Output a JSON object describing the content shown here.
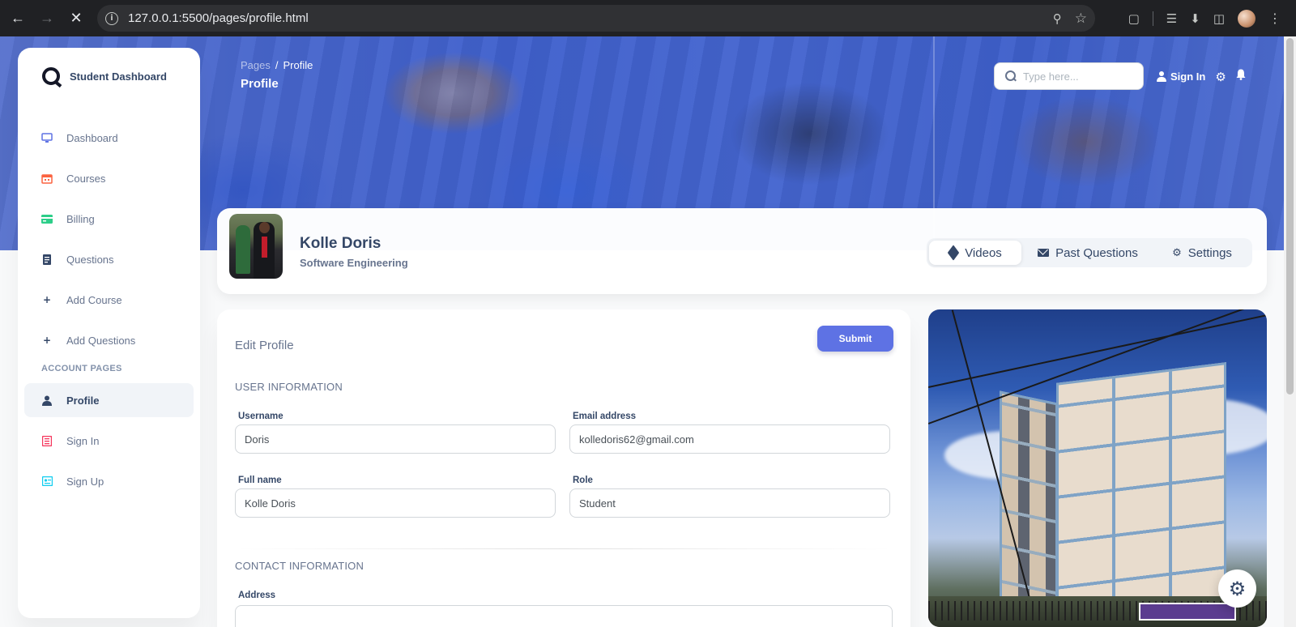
{
  "browser": {
    "url": "127.0.0.1:5500/pages/profile.html"
  },
  "sidebar": {
    "brand": "Student Dashboard",
    "items": [
      {
        "label": "Dashboard",
        "icon": "desktop-icon",
        "color": "#5e72e4"
      },
      {
        "label": "Courses",
        "icon": "calendar-icon",
        "color": "#fb6340"
      },
      {
        "label": "Billing",
        "icon": "credit-card-icon",
        "color": "#2dce89"
      },
      {
        "label": "Questions",
        "icon": "book-icon",
        "color": "#344767"
      },
      {
        "label": "Add Course",
        "icon": "plus-icon",
        "color": "#344767"
      },
      {
        "label": "Add Questions",
        "icon": "plus-icon",
        "color": "#344767"
      }
    ],
    "section_heading": "ACCOUNT PAGES",
    "account_items": [
      {
        "label": "Profile",
        "icon": "user-icon",
        "color": "#344767",
        "active": true
      },
      {
        "label": "Sign In",
        "icon": "document-icon",
        "color": "#f5365c"
      },
      {
        "label": "Sign Up",
        "icon": "id-card-icon",
        "color": "#11cdef"
      }
    ]
  },
  "header": {
    "breadcrumb_root": "Pages",
    "breadcrumb_current": "Profile",
    "title": "Profile",
    "search_placeholder": "Type here...",
    "signin_label": "Sign In"
  },
  "profile": {
    "name": "Kolle Doris",
    "department": "Software Engineering",
    "tabs": [
      {
        "label": "Videos",
        "icon": "cube-icon",
        "active": true
      },
      {
        "label": "Past Questions",
        "icon": "envelope-icon"
      },
      {
        "label": "Settings",
        "icon": "gear-icon"
      }
    ]
  },
  "edit_profile": {
    "title": "Edit Profile",
    "submit_label": "Submit",
    "user_info_heading": "USER INFORMATION",
    "username_label": "Username",
    "username_value": "Doris",
    "email_label": "Email address",
    "email_value": "kolledoris62@gmail.com",
    "fullname_label": "Full name",
    "fullname_value": "Kolle Doris",
    "role_label": "Role",
    "role_value": "Student",
    "contact_heading": "CONTACT INFORMATION",
    "address_label": "Address"
  },
  "colors": {
    "accent": "#5e72e4",
    "text_primary": "#344767",
    "text_secondary": "#67748e"
  }
}
